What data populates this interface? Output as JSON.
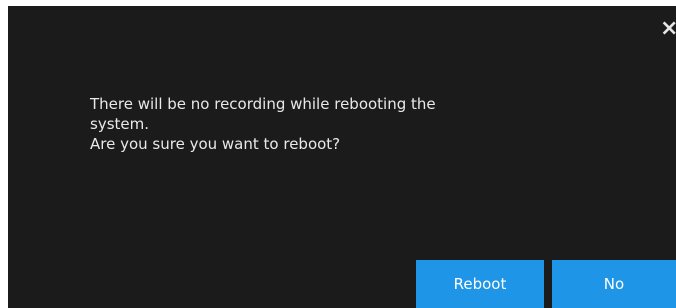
{
  "dialog": {
    "close_icon": "close-icon",
    "close_glyph": "×",
    "message_lines": [
      "There will be no recording while rebooting the",
      "system.",
      "Are you sure you want to reboot?"
    ],
    "buttons": {
      "reboot_label": "Reboot",
      "no_label": "No"
    }
  },
  "colors": {
    "dialog_background": "#1b1b1b",
    "button_background": "#1e95e6",
    "text": "#e9e9e9"
  }
}
